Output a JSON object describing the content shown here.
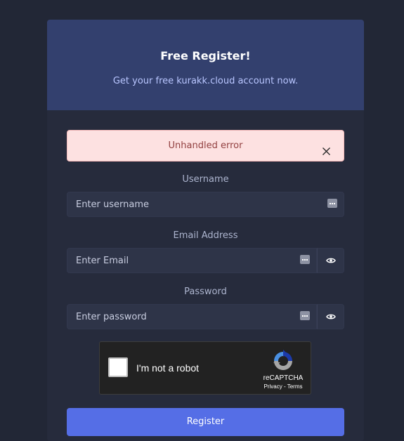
{
  "header": {
    "title": "Free Register!",
    "subtitle": "Get your free kurakk.cloud account now."
  },
  "alert": {
    "message": "Unhandled error",
    "close_icon": "close-icon",
    "color_bg": "#fde1e1",
    "color_text": "#924040"
  },
  "form": {
    "username": {
      "label": "Username",
      "placeholder": "Enter username",
      "value": ""
    },
    "email": {
      "label": "Email Address",
      "placeholder": "Enter Email",
      "value": "",
      "addon_icon": "eye-icon"
    },
    "password": {
      "label": "Password",
      "placeholder": "Enter password",
      "value": "",
      "addon_icon": "eye-icon"
    },
    "autofill_icon": "password-manager-icon"
  },
  "recaptcha": {
    "label": "I'm not a robot",
    "brand": "reCAPTCHA",
    "privacy": "Privacy",
    "separator": " - ",
    "terms": "Terms"
  },
  "register_button": {
    "label": "Register"
  },
  "colors": {
    "page_bg": "#222736",
    "header_bg": "#33406e",
    "card_bg": "#262b3c",
    "input_bg": "#2e3448",
    "accent": "#556ee6"
  }
}
